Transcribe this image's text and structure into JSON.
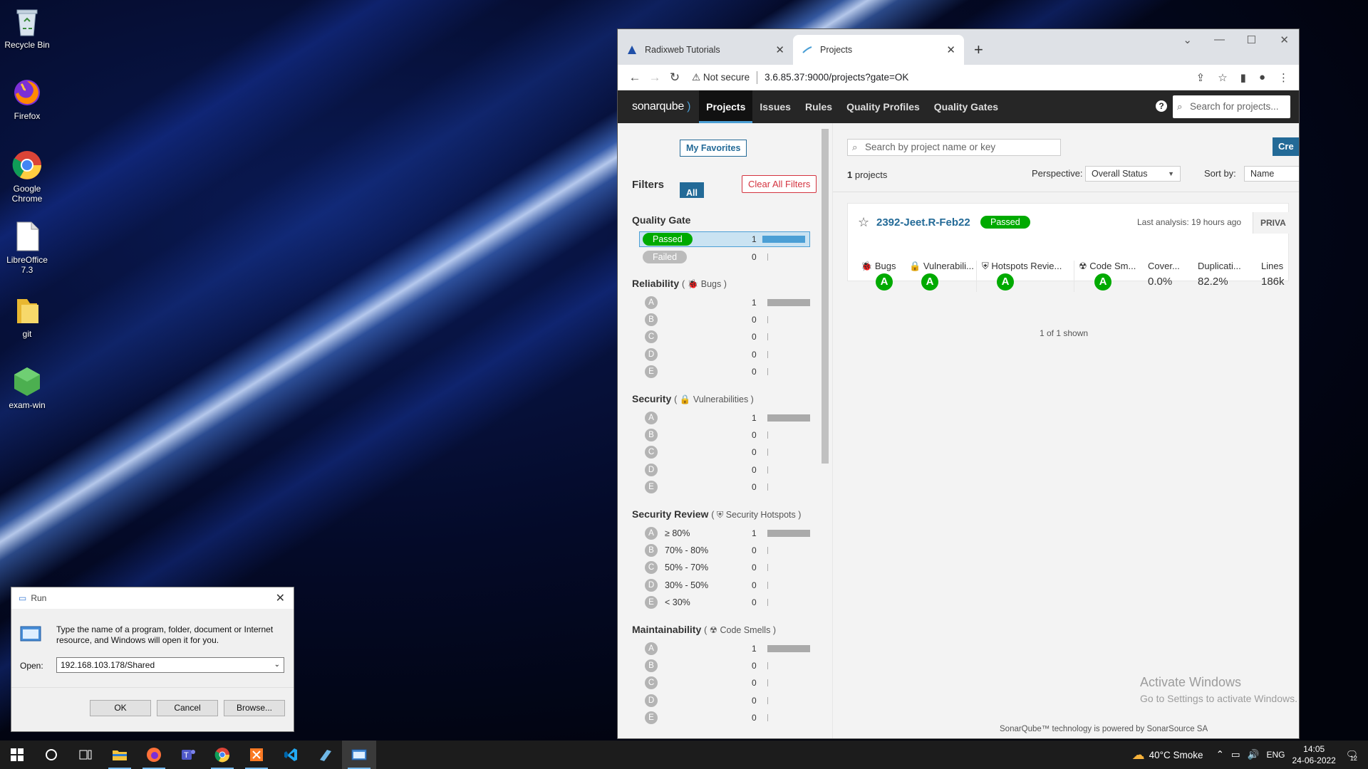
{
  "desktop": {
    "icons": [
      {
        "label": "Recycle Bin",
        "icon": "recycle-bin-icon"
      },
      {
        "label": "Firefox",
        "icon": "firefox-icon"
      },
      {
        "label": "Google Chrome",
        "icon": "chrome-icon"
      },
      {
        "label": "LibreOffice 7.3",
        "icon": "document-icon"
      },
      {
        "label": "git",
        "icon": "folder-icon"
      },
      {
        "label": "exam-win",
        "icon": "cube-icon"
      }
    ]
  },
  "browser": {
    "tabs": [
      {
        "label": "Radixweb Tutorials",
        "active": false
      },
      {
        "label": "Projects",
        "active": true
      }
    ],
    "security": "Not secure",
    "url": "3.6.85.37:9000/projects?gate=OK"
  },
  "sonar": {
    "logo": "sonarqube",
    "nav": [
      "Projects",
      "Issues",
      "Rules",
      "Quality Profiles",
      "Quality Gates"
    ],
    "search_placeholder": "Search for projects...",
    "favorites": "My Favorites",
    "all": "All",
    "filters_title": "Filters",
    "clear_filters": "Clear All Filters",
    "quality_gate": {
      "title": "Quality Gate",
      "rows": [
        {
          "label": "Passed",
          "count": "1"
        },
        {
          "label": "Failed",
          "count": "0"
        }
      ]
    },
    "reliability": {
      "title": "Reliability",
      "sub": "Bugs",
      "rows": [
        [
          "A",
          "",
          "1"
        ],
        [
          "B",
          "",
          "0"
        ],
        [
          "C",
          "",
          "0"
        ],
        [
          "D",
          "",
          "0"
        ],
        [
          "E",
          "",
          "0"
        ]
      ]
    },
    "security": {
      "title": "Security",
      "sub": "Vulnerabilities",
      "rows": [
        [
          "A",
          "",
          "1"
        ],
        [
          "B",
          "",
          "0"
        ],
        [
          "C",
          "",
          "0"
        ],
        [
          "D",
          "",
          "0"
        ],
        [
          "E",
          "",
          "0"
        ]
      ]
    },
    "security_review": {
      "title": "Security Review",
      "sub": "Security Hotspots",
      "rows": [
        [
          "A",
          "≥ 80%",
          "1"
        ],
        [
          "B",
          "70% - 80%",
          "0"
        ],
        [
          "C",
          "50% - 70%",
          "0"
        ],
        [
          "D",
          "30% - 50%",
          "0"
        ],
        [
          "E",
          "< 30%",
          "0"
        ]
      ]
    },
    "maintainability": {
      "title": "Maintainability",
      "sub": "Code Smells",
      "rows": [
        [
          "A",
          "",
          "1"
        ],
        [
          "B",
          "",
          "0"
        ],
        [
          "C",
          "",
          "0"
        ],
        [
          "D",
          "",
          "0"
        ],
        [
          "E",
          "",
          "0"
        ]
      ]
    },
    "main": {
      "search_placeholder": "Search by project name or key",
      "create": "Cre",
      "count_num": "1",
      "count_text": " projects",
      "perspective_label": "Perspective:",
      "perspective_value": "Overall Status",
      "sort_label": "Sort by:",
      "sort_value": "Name",
      "project": {
        "name": "2392-Jeet.R-Feb22",
        "gate": "Passed",
        "last_analysis": "Last analysis: 19 hours ago",
        "visibility": "PRIVA",
        "metrics": [
          {
            "label": "Bugs",
            "grade": "A"
          },
          {
            "label": "Vulnerabili...",
            "grade": "A"
          },
          {
            "label": "Hotspots Revie...",
            "grade": "A"
          },
          {
            "label": "Code Sm...",
            "grade": "A"
          },
          {
            "label": "Cover...",
            "value": "0.0%"
          },
          {
            "label": "Duplicati...",
            "value": "82.2%"
          },
          {
            "label": "Lines",
            "value": "186k"
          }
        ]
      },
      "shown": "1 of 1 shown",
      "footer": "SonarQube™ technology is powered by SonarSource SA"
    }
  },
  "watermark": {
    "line1": "Activate Windows",
    "line2": "Go to Settings to activate Windows."
  },
  "run": {
    "title": "Run",
    "description": "Type the name of a program, folder, document or Internet resource, and Windows will open it for you.",
    "open_label": "Open:",
    "open_value": "192.168.103.178/Shared",
    "ok": "OK",
    "cancel": "Cancel",
    "browse": "Browse..."
  },
  "taskbar": {
    "weather": "40°C  Smoke",
    "lang": "ENG",
    "time": "14:05",
    "date": "24-06-2022",
    "notif_count": "12"
  }
}
